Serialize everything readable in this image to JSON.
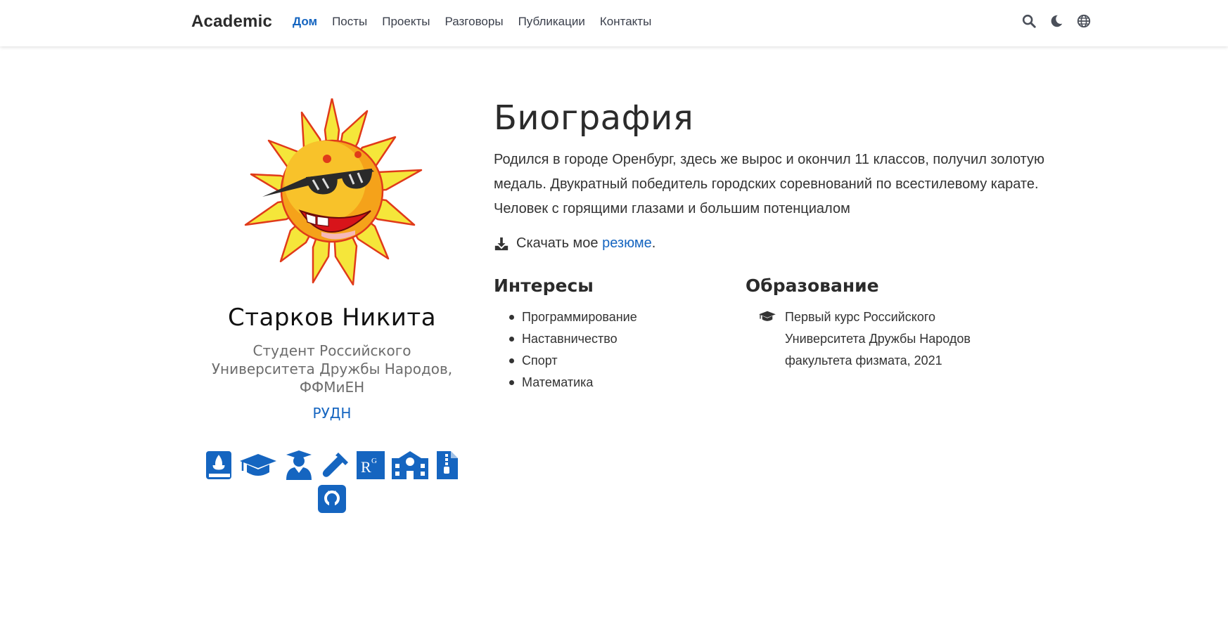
{
  "nav": {
    "brand": "Academic",
    "links": [
      "Дом",
      "Посты",
      "Проекты",
      "Разговоры",
      "Публикации",
      "Контакты"
    ],
    "active_index": 0,
    "icons": [
      "search-icon",
      "moon-icon",
      "globe-icon"
    ]
  },
  "profile": {
    "name": "Старков Никита",
    "role": "Студент Российского Университета Дружбы Народов, ФФМиЕН",
    "org": "РУДН",
    "social_icons": [
      "book-icon",
      "graduation-cap-icon",
      "user-graduate-icon",
      "test-tube-icon",
      "researchgate-icon",
      "school-icon",
      "zip-file-icon",
      "github-icon"
    ]
  },
  "bio": {
    "title": "Биография",
    "text": "Родился в городе Оренбург, здесь же вырос и окончил 11 классов, получил золотую медаль. Двукратный победитель городских соревнований по всестилевому карате. Человек с горящими глазами и большим потенциалом",
    "resume_prefix": "Скачать мое ",
    "resume_link": "резюме",
    "resume_suffix": "."
  },
  "interests": {
    "title": "Интересы",
    "items": [
      "Программирование",
      "Наставничество",
      "Спорт",
      "Математика"
    ]
  },
  "education": {
    "title": "Образование",
    "items": [
      "Первый курс Российского Университета Дружбы Народов факультета физмата, 2021"
    ]
  },
  "colors": {
    "accent": "#1565c0",
    "text": "#2b2b2b",
    "muted": "#6c6c6c"
  }
}
